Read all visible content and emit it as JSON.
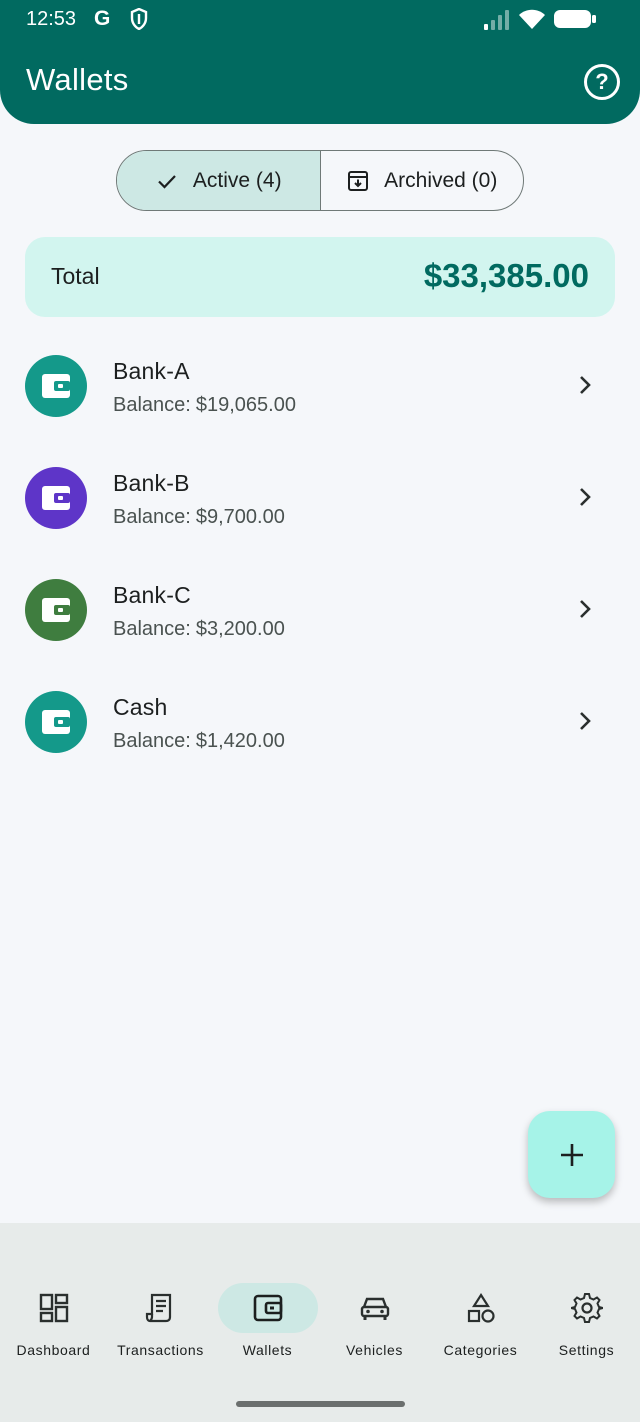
{
  "status_bar": {
    "time": "12:53",
    "g_letter": "G",
    "icons": [
      "shield-icon",
      "signal-icon",
      "wifi-icon",
      "battery-icon"
    ]
  },
  "app_bar": {
    "title": "Wallets",
    "help_icon": "help-circle-icon",
    "help_glyph": "?"
  },
  "filter": {
    "active_label": "Active (4)",
    "archived_label": "Archived (0)",
    "selected": "active"
  },
  "total": {
    "label": "Total",
    "value": "$33,385.00"
  },
  "wallets": [
    {
      "name": "Bank-A",
      "balance_prefix": "Balance:",
      "balance": "$19,065.00",
      "color": "#14998a"
    },
    {
      "name": "Bank-B",
      "balance_prefix": "Balance:",
      "balance": "$9,700.00",
      "color": "#5e35c8"
    },
    {
      "name": "Bank-C",
      "balance_prefix": "Balance:",
      "balance": "$3,200.00",
      "color": "#3f7d3f"
    },
    {
      "name": "Cash",
      "balance_prefix": "Balance:",
      "balance": "$1,420.00",
      "color": "#14998a"
    }
  ],
  "fab": {
    "icon": "add-icon"
  },
  "bottom_nav": [
    {
      "label": "Dashboard",
      "icon": "dashboard-icon",
      "active": false
    },
    {
      "label": "Transactions",
      "icon": "receipt-icon",
      "active": false
    },
    {
      "label": "Wallets",
      "icon": "wallet-icon",
      "active": true
    },
    {
      "label": "Vehicles",
      "icon": "car-icon",
      "active": false
    },
    {
      "label": "Categories",
      "icon": "shapes-icon",
      "active": false
    },
    {
      "label": "Settings",
      "icon": "gear-icon",
      "active": false
    }
  ],
  "colors": {
    "primary": "#016a60",
    "total_card": "#d2f5ef",
    "selected_segment": "#cde8e4",
    "fab": "#a6f3e8",
    "nav_background": "#e7ebea"
  }
}
